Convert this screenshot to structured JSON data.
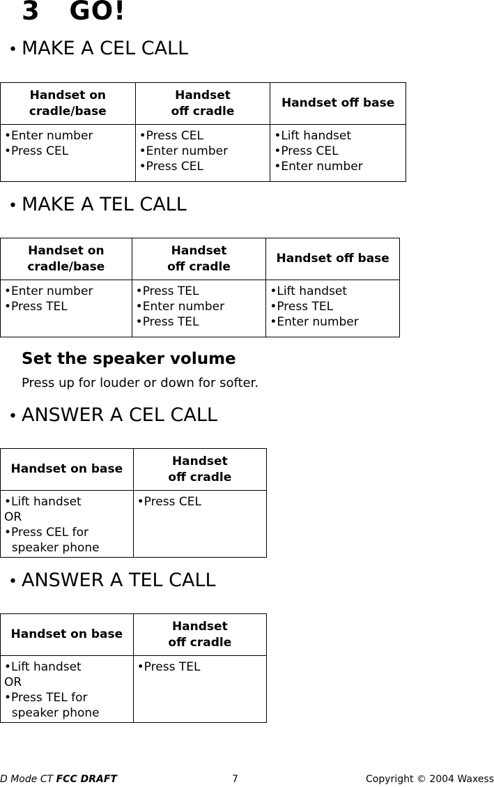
{
  "page_title": "3   GO!",
  "sections": {
    "make_cel": {
      "heading": "MAKE A CEL CALL",
      "headers": [
        "Handset on\ncradle/base",
        "Handset\noff cradle",
        "Handset off base"
      ],
      "cells": [
        [
          "•Enter number",
          "•Press CEL"
        ],
        [
          "•Press CEL",
          "•Enter number",
          "•Press CEL"
        ],
        [
          "•Lift handset",
          "•Press CEL",
          "•Enter number"
        ]
      ]
    },
    "make_tel": {
      "heading": "MAKE A TEL CALL",
      "headers": [
        "Handset on\ncradle/base",
        "Handset\noff cradle",
        "Handset off base"
      ],
      "cells": [
        [
          "•Enter number",
          "•Press TEL"
        ],
        [
          "•Press TEL",
          "•Enter number",
          "•Press TEL"
        ],
        [
          "•Lift handset",
          "•Press TEL",
          "•Enter number"
        ]
      ]
    },
    "speaker": {
      "title": "Set the speaker volume",
      "text": "Press up for louder or down for softer."
    },
    "answer_cel": {
      "heading": "ANSWER A CEL CALL",
      "headers": [
        "Handset on base",
        "Handset\noff cradle"
      ],
      "cells": [
        [
          "•Lift handset",
          "OR",
          "•Press CEL for",
          "  speaker phone"
        ],
        [
          "•Press CEL"
        ]
      ]
    },
    "answer_tel": {
      "heading": "ANSWER A TEL CALL",
      "headers": [
        "Handset on base",
        "Handset\noff cradle"
      ],
      "cells": [
        [
          "•Lift handset",
          "OR",
          "•Press TEL for",
          "  speaker phone"
        ],
        [
          "•Press TEL"
        ]
      ]
    }
  },
  "bullet_glyph": "•",
  "footer": {
    "left_prefix": "D Mode CT ",
    "left_bold": "FCC DRAFT",
    "page_number": "7",
    "copyright": "Copyright © 2004 Waxess"
  }
}
